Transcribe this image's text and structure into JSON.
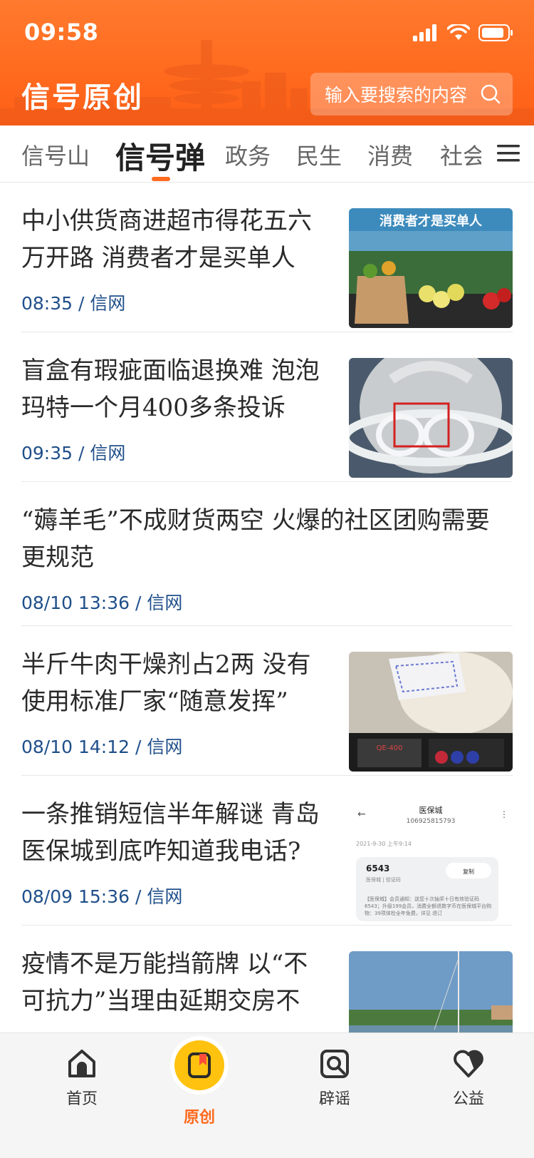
{
  "status_bar": {
    "time": "09:58"
  },
  "header": {
    "logo": "信号原创",
    "search_placeholder": "输入要搜索的内容",
    "accent_color": "#ff6a1e"
  },
  "tabs": [
    {
      "label": "信号山",
      "active": false
    },
    {
      "label": "信号弹",
      "active": true
    },
    {
      "label": "政务",
      "active": false
    },
    {
      "label": "民生",
      "active": false
    },
    {
      "label": "消费",
      "active": false
    },
    {
      "label": "社会",
      "active": false
    }
  ],
  "news": [
    {
      "title": "中小供货商进超市得花五六万开路 消费者才是买单人",
      "meta": "08:35 / 信网",
      "has_image": true,
      "image_caption": "消费者才是买单人"
    },
    {
      "title": "盲盒有瑕疵面临退换难 泡泡玛特一个月400多条投诉",
      "meta": "09:35 / 信网",
      "has_image": true
    },
    {
      "title": "“薅羊毛”不成财货两空 火爆的社区团购需要更规范",
      "meta": "08/10 13:36 / 信网",
      "has_image": false
    },
    {
      "title": "半斤牛肉干燥剂占2两 没有使用标准厂家“随意发挥”",
      "meta": "08/10 14:12 / 信网",
      "has_image": true,
      "scale_reading": "QE-400"
    },
    {
      "title": "一条推销短信半年解谜 青岛医保城到底咋知道我电话?",
      "meta": "08/09 15:36 / 信网",
      "has_image": true,
      "sms": {
        "sender": "医保城",
        "number": "106925815793",
        "date": "2021-9-30 上午9:14",
        "code": "6543",
        "code_sub": "医保城 | 验证码",
        "copy": "复制",
        "body": "【医保城】会员通知：送您十次抽奖十日有效验证码6543；升级199会员，消费全额退数字币在医保城平台购物：39项体检全年免费，详见 退订"
      }
    },
    {
      "title": "疫情不是万能挡箭牌 以“不可抗力”当理由延期交房不",
      "meta": "",
      "has_image": true
    }
  ],
  "bottom_nav": [
    {
      "label": "首页",
      "icon": "home-icon",
      "active": false
    },
    {
      "label": "原创",
      "icon": "original-icon",
      "active": true
    },
    {
      "label": "辟谣",
      "icon": "rumor-check-icon",
      "active": false
    },
    {
      "label": "公益",
      "icon": "charity-heart-icon",
      "active": false
    }
  ]
}
